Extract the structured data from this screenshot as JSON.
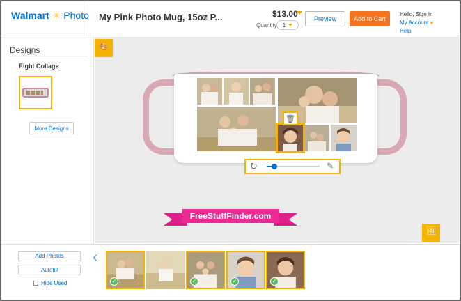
{
  "header": {
    "brand": "Walmart",
    "brand_product": "Photo",
    "product_title": "My Pink Photo Mug, 15oz P...",
    "price": "$13.00",
    "quantity_label": "Quantity",
    "quantity_value": "1",
    "preview_label": "Preview",
    "add_to_cart_label": "Add to Cart",
    "greeting": "Hello, Sign In",
    "account_label": "My Account",
    "help_label": "Help"
  },
  "sidebar": {
    "title": "Designs",
    "selected_design": "Eight Collage",
    "more_designs_label": "More Designs"
  },
  "canvas": {
    "banner_text": "FreeStuffFinder.com",
    "zoom_level": 0.15
  },
  "bottom": {
    "add_photos_label": "Add Photos",
    "autofill_label": "Autofill",
    "hide_used_label": "Hide Used",
    "hide_used_checked": false,
    "thumbnails": [
      {
        "used": true
      },
      {
        "used": false
      },
      {
        "used": true
      },
      {
        "used": true
      },
      {
        "used": true
      }
    ]
  },
  "colors": {
    "brand_blue": "#0071ce",
    "accent_yellow": "#f5b301",
    "cart_orange": "#f47321",
    "mug_pink": "#d9a8b4",
    "banner_pink": "#ec2a93",
    "check_green": "#5cb85c"
  }
}
